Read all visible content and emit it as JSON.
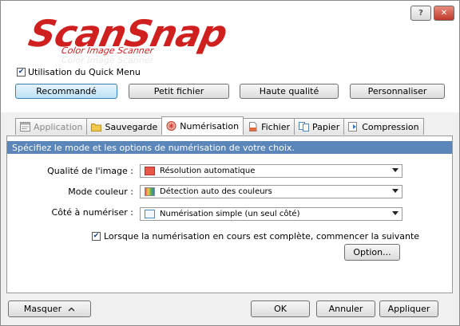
{
  "window": {
    "help_label": "?",
    "close_label": "✕"
  },
  "logo": {
    "main": "ScanSnap",
    "sub": "Color Image Scanner",
    "ghost": "Color Image Scanner"
  },
  "quick_menu": {
    "checked": true,
    "label": "Utilisation du Quick Menu"
  },
  "presets": [
    {
      "label": "Recommandé",
      "selected": true
    },
    {
      "label": "Petit fichier",
      "selected": false
    },
    {
      "label": "Haute qualité",
      "selected": false
    },
    {
      "label": "Personnaliser",
      "selected": false
    }
  ],
  "tabs": [
    {
      "label": "Application",
      "icon": "application-icon",
      "state": "disabled"
    },
    {
      "label": "Sauvegarde",
      "icon": "folder-icon",
      "state": "normal"
    },
    {
      "label": "Numérisation",
      "icon": "scan-icon",
      "state": "active"
    },
    {
      "label": "Fichier",
      "icon": "file-icon",
      "state": "normal"
    },
    {
      "label": "Papier",
      "icon": "paper-icon",
      "state": "normal"
    },
    {
      "label": "Compression",
      "icon": "compression-icon",
      "state": "normal"
    }
  ],
  "scan": {
    "banner": "Spécifiez le mode et les options de numérisation de votre choix.",
    "image_quality": {
      "label": "Qualité de l'image :",
      "value": "Résolution automatique"
    },
    "color_mode": {
      "label": "Mode couleur :",
      "value": "Détection auto des couleurs"
    },
    "sides": {
      "label": "Côté à numériser :",
      "value": "Numérisation simple (un seul côté)"
    },
    "continue_checkbox": {
      "checked": true,
      "label": "Lorsque la numérisation en cours est complète, commencer la suivante"
    },
    "option_label": "Option..."
  },
  "footer": {
    "hide_label": "Masquer",
    "ok_label": "OK",
    "cancel_label": "Annuler",
    "apply_label": "Appliquer"
  },
  "colors": {
    "banner_bg": "#5b86b9",
    "logo_red": "#d01f1f",
    "selected_preset": "#bde1f7"
  }
}
